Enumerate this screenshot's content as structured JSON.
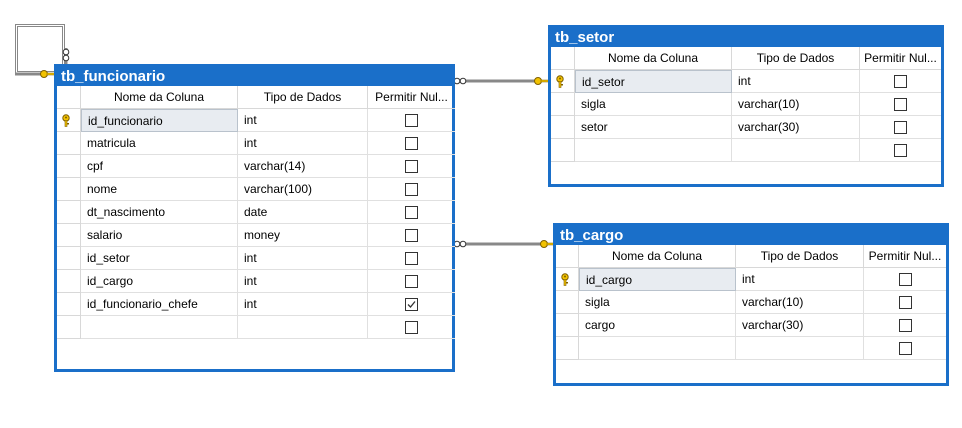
{
  "columns_header": {
    "name": "Nome da Coluna",
    "type": "Tipo de Dados",
    "null": "Permitir Nul..."
  },
  "tables": {
    "tb_funcionario": {
      "title": "tb_funcionario",
      "rows": [
        {
          "name": "id_funcionario",
          "type": "int",
          "nullable": false,
          "pk": true
        },
        {
          "name": "matricula",
          "type": "int",
          "nullable": false
        },
        {
          "name": "cpf",
          "type": "varchar(14)",
          "nullable": false
        },
        {
          "name": "nome",
          "type": "varchar(100)",
          "nullable": false
        },
        {
          "name": "dt_nascimento",
          "type": "date",
          "nullable": false
        },
        {
          "name": "salario",
          "type": "money",
          "nullable": false
        },
        {
          "name": "id_setor",
          "type": "int",
          "nullable": false
        },
        {
          "name": "id_cargo",
          "type": "int",
          "nullable": false
        },
        {
          "name": "id_funcionario_chefe",
          "type": "int",
          "nullable": true
        },
        {
          "name": "",
          "type": "",
          "nullable": false
        }
      ]
    },
    "tb_setor": {
      "title": "tb_setor",
      "rows": [
        {
          "name": "id_setor",
          "type": "int",
          "nullable": false,
          "pk": true
        },
        {
          "name": "sigla",
          "type": "varchar(10)",
          "nullable": false
        },
        {
          "name": "setor",
          "type": "varchar(30)",
          "nullable": false
        },
        {
          "name": "",
          "type": "",
          "nullable": false
        }
      ]
    },
    "tb_cargo": {
      "title": "tb_cargo",
      "rows": [
        {
          "name": "id_cargo",
          "type": "int",
          "nullable": false,
          "pk": true
        },
        {
          "name": "sigla",
          "type": "varchar(10)",
          "nullable": false
        },
        {
          "name": "cargo",
          "type": "varchar(30)",
          "nullable": false
        },
        {
          "name": "",
          "type": "",
          "nullable": false
        }
      ]
    }
  },
  "colors": {
    "title_bar": "#1a6fc9",
    "key_icon": "#f2c200"
  }
}
